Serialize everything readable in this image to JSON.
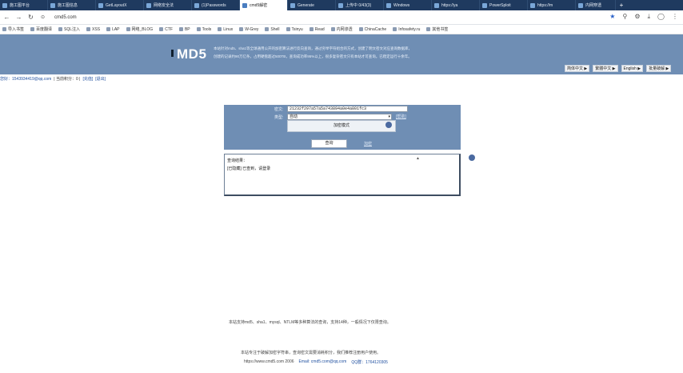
{
  "browser": {
    "tabs": [
      {
        "label": "施工图平台"
      },
      {
        "label": "施工图信息"
      },
      {
        "label": "GetLayoutX"
      },
      {
        "label": "网络安全法"
      },
      {
        "label": "(1)Passwords"
      },
      {
        "label": "cmd5解密"
      },
      {
        "label": "Generate"
      },
      {
        "label": "上传中 0/43(3)"
      },
      {
        "label": "Windows"
      },
      {
        "label": "https://ya"
      },
      {
        "label": "PowerSploit"
      },
      {
        "label": "https://m"
      },
      {
        "label": "内网穿透"
      }
    ],
    "active_tab_index": 5,
    "url": "cmd5.com",
    "bookmarks": [
      {
        "label": "导入书签"
      },
      {
        "label": "百度翻译"
      },
      {
        "label": "SQL注入"
      },
      {
        "label": "XSS"
      },
      {
        "label": "LAP"
      },
      {
        "label": "网络_BLOG"
      },
      {
        "label": "CTF"
      },
      {
        "label": "BP"
      },
      {
        "label": "Tools"
      },
      {
        "label": "Linux"
      },
      {
        "label": "W-Grey"
      },
      {
        "label": "Shell"
      },
      {
        "label": "Tsinyu"
      },
      {
        "label": "Read"
      },
      {
        "label": "内网渗透"
      },
      {
        "label": "ChinaCache"
      },
      {
        "label": "Infosafety.ru"
      },
      {
        "label": "其他书签"
      }
    ]
  },
  "site": {
    "logo": "MD5",
    "intro_lines": [
      "本站针对md5、sha1等全球通用公开的加密算法进行反向查询，通过穷举字符组合的方式，创建了明文密文对应查询数据库，",
      "创建的记录约90万亿条，占用硬盘超过500TB，查询成功率95%以上，很多复杂密文只有本站才可查询。已稳定运行十余年。"
    ],
    "lang_links": [
      "简体中文 ▶",
      "繁體中文 ▶",
      "English ▶",
      "批量破解 ▶"
    ],
    "user_line": {
      "account": "您好：1543934419@qq.com",
      "balance": "| 当前积分：0 |",
      "recharge": "[充值]",
      "logout": "[退出]"
    }
  },
  "form": {
    "hash_label": "密文:",
    "hash_value": "21232f297a57a5a743894a0e4a801fc3",
    "type_label": "类型:",
    "type_value": "自动",
    "advanced_link": "[帮助]",
    "dropdown_option": "加密模式",
    "query_button": "查询",
    "encrypt_link": "加密"
  },
  "result": {
    "title": "查询结果：",
    "text": "[已隐藏] 已查到，请登录",
    "scroll_mark": "▲"
  },
  "footer": {
    "note": "本站支持md5、sha1、mysql、NTLM等多种算法的查询，支持14种，一般情况下仅限查询。",
    "line1": "本站专注于破解加密字符串，查询密文需要消耗积分，我们推荐注册用户使用。",
    "copyright": "https://www.cmd5.com 2006",
    "email": "Email: cmd5.com@qq.com",
    "icp": "QQ群：1764120305"
  }
}
